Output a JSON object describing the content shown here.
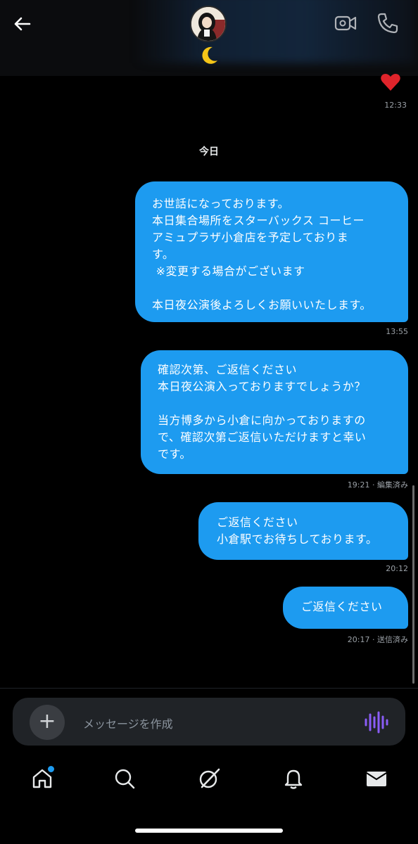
{
  "header": {
    "back_icon": "back-arrow-icon",
    "moon_emoji": "🌙",
    "video_icon": "video-call-icon",
    "phone_icon": "phone-call-icon"
  },
  "previous": {
    "reaction": "❤️",
    "time": "12:33"
  },
  "date_separator": "今日",
  "messages": [
    {
      "text": "お世話になっております。\n本日集合場所をスターバックス コーヒー\nアミュプラザ小倉店を予定しておりま\nす。\n ※変更する場合がございます\n\n本日夜公演後よろしくお願いいたします。",
      "meta": "13:55"
    },
    {
      "text": "確認次第、ご返信ください\n本日夜公演入っておりますでしょうか？\n\n当方博多から小倉に向かっておりますの\nで、確認次第ご返信いただけますと幸い\nです。",
      "meta": "19:21 · 編集済み"
    },
    {
      "text": "ご返信ください\n小倉駅でお待ちしております。",
      "meta": "20:12"
    },
    {
      "text": "ご返信ください",
      "meta": "20:17 · 送信済み"
    }
  ],
  "composer": {
    "placeholder": "メッセージを作成",
    "plus_label": "+"
  },
  "nav": [
    "home-icon",
    "search-icon",
    "grok-icon",
    "notifications-icon",
    "messages-icon"
  ],
  "colors": {
    "accent": "#1d9bf0",
    "background": "#000000",
    "composer": "#202327",
    "voice": "#8a5cf6"
  }
}
